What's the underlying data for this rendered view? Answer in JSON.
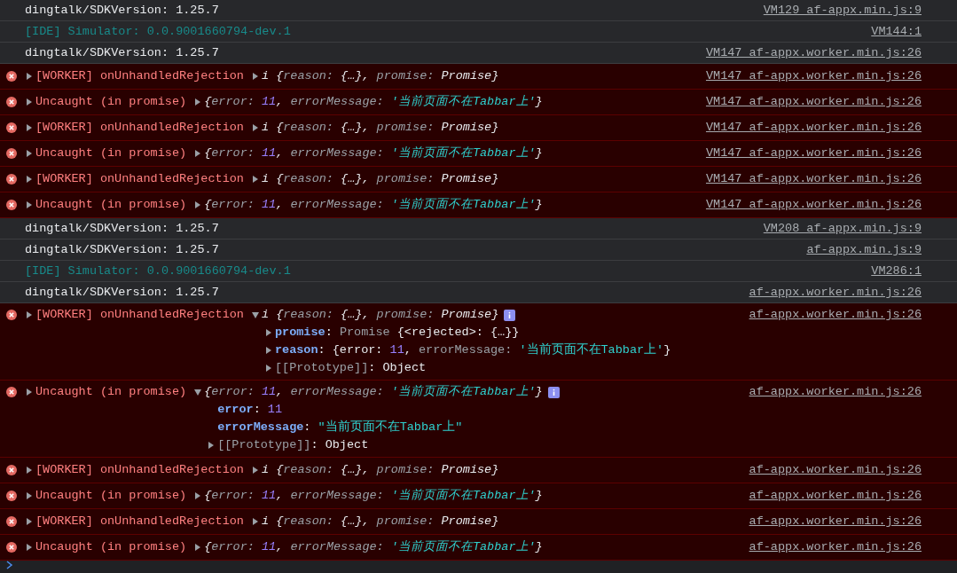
{
  "rows": [
    {
      "kind": "log",
      "text": "dingtalk/SDKVersion: 1.25.7",
      "source": "VM129 af-appx.min.js:9"
    },
    {
      "kind": "info",
      "text": "[IDE] Simulator: 0.0.9001660794-dev.1",
      "source": "VM144:1"
    },
    {
      "kind": "log",
      "text": "dingtalk/SDKVersion: 1.25.7",
      "source": "VM147 af-appx.worker.min.js:26"
    },
    {
      "kind": "error",
      "label": "[WORKER] onUnhandledRejection",
      "expanded": false,
      "prefix": "i",
      "preview": [
        {
          "kind": "punct",
          "text": "{"
        },
        {
          "kind": "key",
          "text": "reason: "
        },
        {
          "kind": "punct",
          "text": "{…}, "
        },
        {
          "kind": "key",
          "text": "promise: "
        },
        {
          "kind": "value",
          "text": "Promise"
        },
        {
          "kind": "punct",
          "text": "}"
        }
      ],
      "source": "VM147 af-appx.worker.min.js:26"
    },
    {
      "kind": "error",
      "label": "Uncaught (in promise)",
      "expanded": false,
      "preview": [
        {
          "kind": "punct",
          "text": "{"
        },
        {
          "kind": "key",
          "text": "error: "
        },
        {
          "kind": "number",
          "text": "11"
        },
        {
          "kind": "punct",
          "text": ", "
        },
        {
          "kind": "key",
          "text": "errorMessage: "
        },
        {
          "kind": "string",
          "text": "'当前页面不在Tabbar上'"
        },
        {
          "kind": "punct",
          "text": "}"
        }
      ],
      "source": "VM147 af-appx.worker.min.js:26"
    },
    {
      "kind": "error",
      "label": "[WORKER] onUnhandledRejection",
      "expanded": false,
      "prefix": "i",
      "preview": [
        {
          "kind": "punct",
          "text": "{"
        },
        {
          "kind": "key",
          "text": "reason: "
        },
        {
          "kind": "punct",
          "text": "{…}, "
        },
        {
          "kind": "key",
          "text": "promise: "
        },
        {
          "kind": "value",
          "text": "Promise"
        },
        {
          "kind": "punct",
          "text": "}"
        }
      ],
      "source": "VM147 af-appx.worker.min.js:26"
    },
    {
      "kind": "error",
      "label": "Uncaught (in promise)",
      "expanded": false,
      "preview": [
        {
          "kind": "punct",
          "text": "{"
        },
        {
          "kind": "key",
          "text": "error: "
        },
        {
          "kind": "number",
          "text": "11"
        },
        {
          "kind": "punct",
          "text": ", "
        },
        {
          "kind": "key",
          "text": "errorMessage: "
        },
        {
          "kind": "string",
          "text": "'当前页面不在Tabbar上'"
        },
        {
          "kind": "punct",
          "text": "}"
        }
      ],
      "source": "VM147 af-appx.worker.min.js:26"
    },
    {
      "kind": "error",
      "label": "[WORKER] onUnhandledRejection",
      "expanded": false,
      "prefix": "i",
      "preview": [
        {
          "kind": "punct",
          "text": "{"
        },
        {
          "kind": "key",
          "text": "reason: "
        },
        {
          "kind": "punct",
          "text": "{…}, "
        },
        {
          "kind": "key",
          "text": "promise: "
        },
        {
          "kind": "value",
          "text": "Promise"
        },
        {
          "kind": "punct",
          "text": "}"
        }
      ],
      "source": "VM147 af-appx.worker.min.js:26"
    },
    {
      "kind": "error",
      "label": "Uncaught (in promise)",
      "expanded": false,
      "preview": [
        {
          "kind": "punct",
          "text": "{"
        },
        {
          "kind": "key",
          "text": "error: "
        },
        {
          "kind": "number",
          "text": "11"
        },
        {
          "kind": "punct",
          "text": ", "
        },
        {
          "kind": "key",
          "text": "errorMessage: "
        },
        {
          "kind": "string",
          "text": "'当前页面不在Tabbar上'"
        },
        {
          "kind": "punct",
          "text": "}"
        }
      ],
      "source": "VM147 af-appx.worker.min.js:26"
    },
    {
      "kind": "log",
      "text": "dingtalk/SDKVersion: 1.25.7",
      "source": "VM208 af-appx.min.js:9"
    },
    {
      "kind": "log",
      "text": "dingtalk/SDKVersion: 1.25.7",
      "source": "af-appx.min.js:9"
    },
    {
      "kind": "info",
      "text": "[IDE] Simulator: 0.0.9001660794-dev.1",
      "source": "VM286:1"
    },
    {
      "kind": "log",
      "text": "dingtalk/SDKVersion: 1.25.7",
      "source": "af-appx.worker.min.js:26"
    },
    {
      "kind": "error",
      "label": "[WORKER] onUnhandledRejection",
      "expanded": true,
      "prefix": "i",
      "preview": [
        {
          "kind": "punct",
          "text": "{"
        },
        {
          "kind": "key",
          "text": "reason: "
        },
        {
          "kind": "punct",
          "text": "{…}, "
        },
        {
          "kind": "key",
          "text": "promise: "
        },
        {
          "kind": "value",
          "text": "Promise"
        },
        {
          "kind": "punct",
          "text": "}"
        }
      ],
      "source": "af-appx.worker.min.js:26",
      "children": [
        {
          "expandable": true,
          "tokens": [
            {
              "kind": "prop",
              "text": "promise"
            },
            {
              "kind": "plain",
              "text": ": "
            },
            {
              "kind": "dim",
              "text": "Promise "
            },
            {
              "kind": "plain",
              "text": "{<rejected>: {…}}"
            }
          ]
        },
        {
          "expandable": true,
          "tokens": [
            {
              "kind": "prop",
              "text": "reason"
            },
            {
              "kind": "plain",
              "text": ": {error: "
            },
            {
              "kind": "number",
              "text": "11"
            },
            {
              "kind": "plain",
              "text": ", "
            },
            {
              "kind": "dim",
              "text": "errorMessage: "
            },
            {
              "kind": "string",
              "text": "'当前页面不在Tabbar上'"
            },
            {
              "kind": "plain",
              "text": "}"
            }
          ]
        },
        {
          "expandable": true,
          "tokens": [
            {
              "kind": "dim",
              "text": "[[Prototype]]"
            },
            {
              "kind": "plain",
              "text": ": Object"
            }
          ]
        }
      ]
    },
    {
      "kind": "error",
      "label": "Uncaught (in promise)",
      "expanded": true,
      "preview": [
        {
          "kind": "punct",
          "text": "{"
        },
        {
          "kind": "key",
          "text": "error: "
        },
        {
          "kind": "number",
          "text": "11"
        },
        {
          "kind": "punct",
          "text": ", "
        },
        {
          "kind": "key",
          "text": "errorMessage: "
        },
        {
          "kind": "string",
          "text": "'当前页面不在Tabbar上'"
        },
        {
          "kind": "punct",
          "text": "}"
        }
      ],
      "source": "af-appx.worker.min.js:26",
      "children": [
        {
          "expandable": false,
          "tokens": [
            {
              "kind": "prop",
              "text": "error"
            },
            {
              "kind": "plain",
              "text": ": "
            },
            {
              "kind": "number",
              "text": "11"
            }
          ]
        },
        {
          "expandable": false,
          "tokens": [
            {
              "kind": "prop",
              "text": "errorMessage"
            },
            {
              "kind": "plain",
              "text": ": "
            },
            {
              "kind": "string",
              "text": "\"当前页面不在Tabbar上\""
            }
          ]
        },
        {
          "expandable": true,
          "tokens": [
            {
              "kind": "dim",
              "text": "[[Prototype]]"
            },
            {
              "kind": "plain",
              "text": ": Object"
            }
          ]
        }
      ]
    },
    {
      "kind": "error",
      "label": "[WORKER] onUnhandledRejection",
      "expanded": false,
      "prefix": "i",
      "preview": [
        {
          "kind": "punct",
          "text": "{"
        },
        {
          "kind": "key",
          "text": "reason: "
        },
        {
          "kind": "punct",
          "text": "{…}, "
        },
        {
          "kind": "key",
          "text": "promise: "
        },
        {
          "kind": "value",
          "text": "Promise"
        },
        {
          "kind": "punct",
          "text": "}"
        }
      ],
      "source": "af-appx.worker.min.js:26"
    },
    {
      "kind": "error",
      "label": "Uncaught (in promise)",
      "expanded": false,
      "preview": [
        {
          "kind": "punct",
          "text": "{"
        },
        {
          "kind": "key",
          "text": "error: "
        },
        {
          "kind": "number",
          "text": "11"
        },
        {
          "kind": "punct",
          "text": ", "
        },
        {
          "kind": "key",
          "text": "errorMessage: "
        },
        {
          "kind": "string",
          "text": "'当前页面不在Tabbar上'"
        },
        {
          "kind": "punct",
          "text": "}"
        }
      ],
      "source": "af-appx.worker.min.js:26"
    },
    {
      "kind": "error",
      "label": "[WORKER] onUnhandledRejection",
      "expanded": false,
      "prefix": "i",
      "preview": [
        {
          "kind": "punct",
          "text": "{"
        },
        {
          "kind": "key",
          "text": "reason: "
        },
        {
          "kind": "punct",
          "text": "{…}, "
        },
        {
          "kind": "key",
          "text": "promise: "
        },
        {
          "kind": "value",
          "text": "Promise"
        },
        {
          "kind": "punct",
          "text": "}"
        }
      ],
      "source": "af-appx.worker.min.js:26"
    },
    {
      "kind": "error",
      "label": "Uncaught (in promise)",
      "expanded": false,
      "preview": [
        {
          "kind": "punct",
          "text": "{"
        },
        {
          "kind": "key",
          "text": "error: "
        },
        {
          "kind": "number",
          "text": "11"
        },
        {
          "kind": "punct",
          "text": ", "
        },
        {
          "kind": "key",
          "text": "errorMessage: "
        },
        {
          "kind": "string",
          "text": "'当前页面不在Tabbar上'"
        },
        {
          "kind": "punct",
          "text": "}"
        }
      ],
      "source": "af-appx.worker.min.js:26"
    }
  ]
}
